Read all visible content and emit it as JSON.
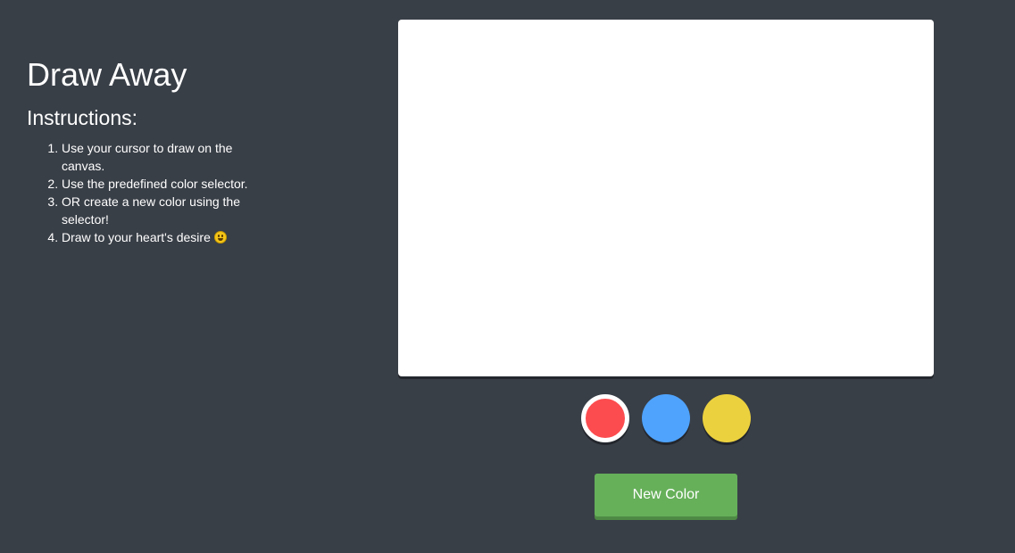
{
  "sidebar": {
    "title": "Draw Away",
    "subtitle": "Instructions:",
    "instructions": [
      "Use your cursor to draw on the canvas.",
      "Use the predefined color selector.",
      "OR create a new color using the selector!",
      "Draw to your heart's desire"
    ],
    "last_item_icon": "smiley-emoji-icon"
  },
  "palette": {
    "colors": [
      "#fc4c4f",
      "#4fa3fc",
      "#ecd13f"
    ],
    "selected_index": 0,
    "selected_ring_color": "#ffffff"
  },
  "controls": {
    "new_color_label": "New Color",
    "new_color_button_color": "#66b05a"
  },
  "theme": {
    "background": "#393f47",
    "canvas_background": "#ffffff"
  }
}
